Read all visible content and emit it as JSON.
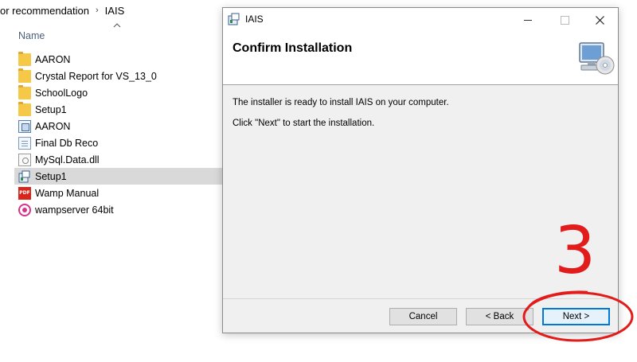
{
  "explorer": {
    "breadcrumb": [
      "or recommendation",
      "IAIS"
    ],
    "column_name": "Name",
    "files": [
      {
        "name": "AARON",
        "icon": "folder-icon",
        "selected": false
      },
      {
        "name": "Crystal Report for VS_13_0",
        "icon": "folder-icon",
        "selected": false
      },
      {
        "name": "SchoolLogo",
        "icon": "folder-icon",
        "selected": false
      },
      {
        "name": "Setup1",
        "icon": "folder-icon",
        "selected": false
      },
      {
        "name": "AARON",
        "icon": "application-icon",
        "selected": false
      },
      {
        "name": "Final Db Reco",
        "icon": "document-icon",
        "selected": false
      },
      {
        "name": "MySql.Data.dll",
        "icon": "dll-file-icon",
        "selected": false
      },
      {
        "name": "Setup1",
        "icon": "setup-installer-icon",
        "selected": true
      },
      {
        "name": "Wamp Manual",
        "icon": "pdf-icon",
        "selected": false
      },
      {
        "name": "wampserver 64bit",
        "icon": "wampserver-icon",
        "selected": false
      }
    ]
  },
  "dialog": {
    "title": "IAIS",
    "heading": "Confirm Installation",
    "message_1": "The installer is ready to install IAIS on your computer.",
    "message_2": "Click \"Next\" to start the installation.",
    "buttons": {
      "cancel": "Cancel",
      "back": "< Back",
      "next": "Next >"
    }
  },
  "annotation": {
    "step_number": "3",
    "color": "#e21b1b"
  },
  "colors": {
    "selected_row": "#d9d9d9",
    "dialog_body": "#f0f0f0",
    "default_button_border": "#0078d7"
  }
}
